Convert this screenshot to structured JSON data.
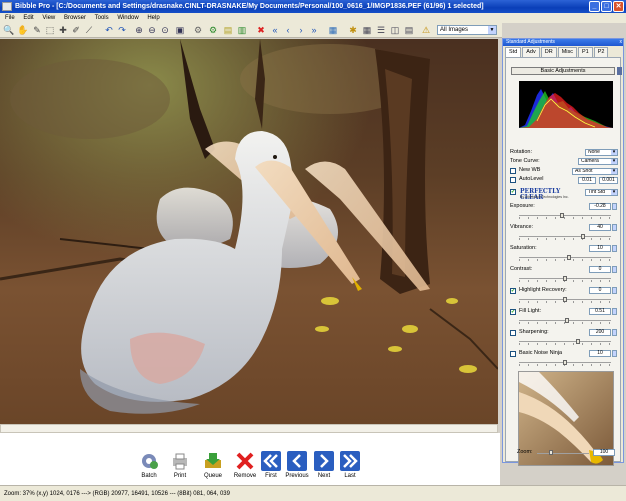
{
  "window": {
    "title": "Bibble Pro - [C:/Documents and Settings/drasnake.CINLT-DRASNAKE/My Documents/Personal/100_0616_1/IMGP1836.PEF  (61/96)  1 selected]",
    "minimize": "_",
    "maximize": "□",
    "close": "✕"
  },
  "menu": [
    "File",
    "Edit",
    "View",
    "Browser",
    "Tools",
    "Window",
    "Help"
  ],
  "toolbar": {
    "images_filter": "All Images"
  },
  "filmstrip": {
    "buttons": [
      "Batch",
      "Print",
      "Queue",
      "Remove",
      "First",
      "Previous",
      "Next",
      "Last"
    ]
  },
  "status": {
    "text": "Zoom:  37% (x,y) 1024, 0176 ---> (RGB) 20977, 16491, 10526 --- (8Bit) 081, 064, 039"
  },
  "panel": {
    "title": "Standard Adjustments",
    "close": "x",
    "tabs": [
      "Std",
      "Adv",
      "DR",
      "Misc",
      "P1",
      "P2"
    ],
    "active_tab": "Std",
    "basic_adjustments": "Basic Adjustments",
    "rotation": {
      "label": "Rotation:",
      "value": "None"
    },
    "tone_curve": {
      "label": "Tone Curve:",
      "value": "Camera"
    },
    "new_wb": {
      "label": "New WB",
      "value": "As Shot"
    },
    "autolevel": {
      "label": "AutoLevel",
      "value1": "0.01",
      "value2": "0.001"
    },
    "perfectly_clear": {
      "logo": "PERFECTLY CLEAR",
      "sub": "By Athentech Technologies Inc.",
      "value": "Tint Std"
    },
    "exposure": {
      "label": "Exposure:",
      "value": "-0.28",
      "level": 0.47
    },
    "vibrance": {
      "label": "Vibrance:",
      "value": "40",
      "level": 0.7
    },
    "saturation": {
      "label": "Saturation:",
      "value": "10",
      "level": 0.55
    },
    "contrast": {
      "label": "Contrast:",
      "value": "0",
      "level": 0.5
    },
    "highlight_recovery": {
      "label": "Highlight Recovery:",
      "value": "0",
      "level": 0.5
    },
    "fill_light": {
      "label": "Fill Light:",
      "value": "0.51",
      "level": 0.52
    },
    "sharpening": {
      "label": "Sharpening:",
      "value": "200",
      "level": 0.65
    },
    "noise_ninja": {
      "label": "Basic Noise Ninja",
      "value": "10",
      "level": 0.5
    },
    "zoom": {
      "label": "Zoom:",
      "value": "100"
    }
  }
}
